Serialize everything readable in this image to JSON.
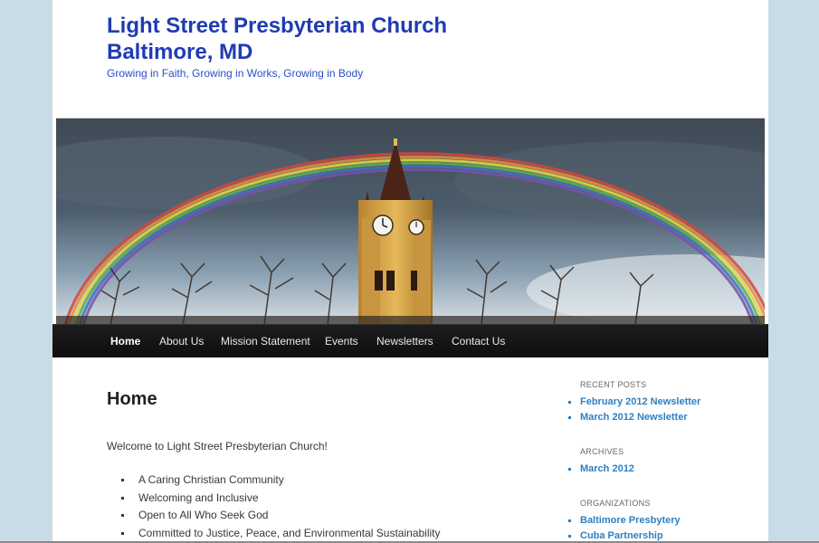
{
  "header": {
    "title_line1": "Light Street Presbyterian Church",
    "title_line2": "Baltimore, MD",
    "tagline": "Growing in Faith, Growing in Works, Growing in Body"
  },
  "nav": {
    "items": [
      {
        "label": "Home",
        "active": true
      },
      {
        "label": "About Us"
      },
      {
        "label": "Mission Statement"
      },
      {
        "label": "Events"
      },
      {
        "label": "Newsletters"
      },
      {
        "label": "Contact Us"
      }
    ]
  },
  "main": {
    "title": "Home",
    "welcome": "Welcome to Light Street Presbyterian Church!",
    "bullets": [
      "A Caring Christian Community",
      "Welcoming and Inclusive",
      "Open to All Who Seek God",
      "Committed to Justice, Peace, and Environmental Sustainability"
    ]
  },
  "sidebar": {
    "recent_posts": {
      "title": "RECENT POSTS",
      "items": [
        "February 2012 Newsletter",
        "March 2012 Newsletter"
      ]
    },
    "archives": {
      "title": "ARCHIVES",
      "items": [
        "March 2012"
      ]
    },
    "organizations": {
      "title": "ORGANIZATIONS",
      "items": [
        "Baltimore Presbytery",
        "Cuba Partnership"
      ]
    }
  },
  "colors": {
    "title": "#1f3bb3",
    "link": "#2f7fc0",
    "navbar": "#111111",
    "background": "#c9dbe6"
  }
}
